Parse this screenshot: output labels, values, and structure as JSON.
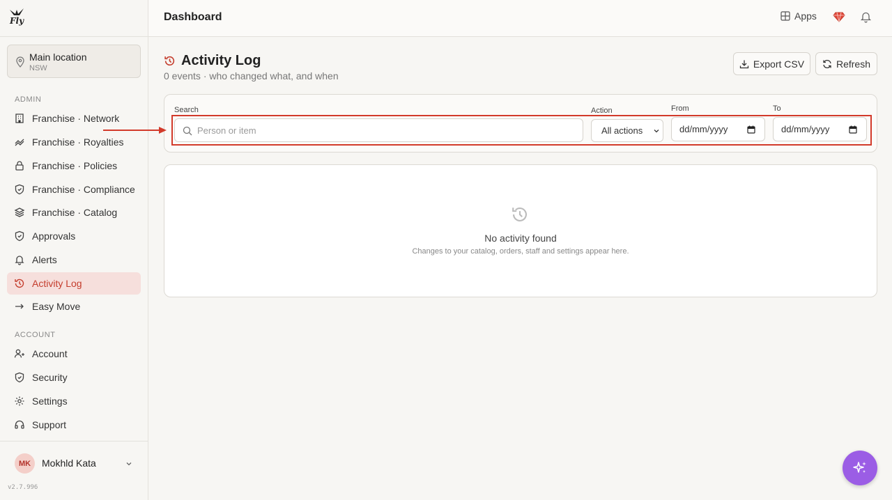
{
  "brand": {
    "logo_text": "Fly"
  },
  "header": {
    "title": "Dashboard",
    "apps_label": "Apps"
  },
  "location": {
    "name": "Main location",
    "region": "NSW"
  },
  "sidebar": {
    "admin_label": "ADMIN",
    "account_label": "ACCOUNT",
    "admin_items": [
      {
        "label": "Franchise · Network",
        "icon": "building-icon"
      },
      {
        "label": "Franchise · Royalties",
        "icon": "coins-icon"
      },
      {
        "label": "Franchise · Policies",
        "icon": "lock-icon"
      },
      {
        "label": "Franchise · Compliance",
        "icon": "shield-icon"
      },
      {
        "label": "Franchise · Catalog",
        "icon": "layers-icon"
      },
      {
        "label": "Approvals",
        "icon": "shield-check-icon"
      },
      {
        "label": "Alerts",
        "icon": "bell-icon"
      },
      {
        "label": "Activity Log",
        "icon": "history-icon",
        "active": true
      },
      {
        "label": "Easy Move",
        "icon": "arrow-right-icon"
      }
    ],
    "account_items": [
      {
        "label": "Account",
        "icon": "user-icon"
      },
      {
        "label": "Security",
        "icon": "shield-icon"
      },
      {
        "label": "Settings",
        "icon": "gear-icon"
      },
      {
        "label": "Support",
        "icon": "headset-icon"
      }
    ]
  },
  "user": {
    "initials": "MK",
    "name": "Mokhld Kata"
  },
  "version": "v2.7.996",
  "page": {
    "title": "Activity Log",
    "subtitle": "0 events · who changed what, and when",
    "export_label": "Export CSV",
    "refresh_label": "Refresh"
  },
  "filters": {
    "search_label": "Search",
    "search_placeholder": "Person or item",
    "action_label": "Action",
    "action_value": "All actions",
    "from_label": "From",
    "from_value": "dd/mm/yyyy",
    "to_label": "To",
    "to_value": "dd/mm/yyyy"
  },
  "empty": {
    "title": "No activity found",
    "subtitle": "Changes to your catalog, orders, staff and settings appear here."
  },
  "colors": {
    "accent": "#c43c2c",
    "active_bg": "#f6dfdc",
    "fab": "#9b5de5",
    "highlight": "#d23a2a"
  }
}
